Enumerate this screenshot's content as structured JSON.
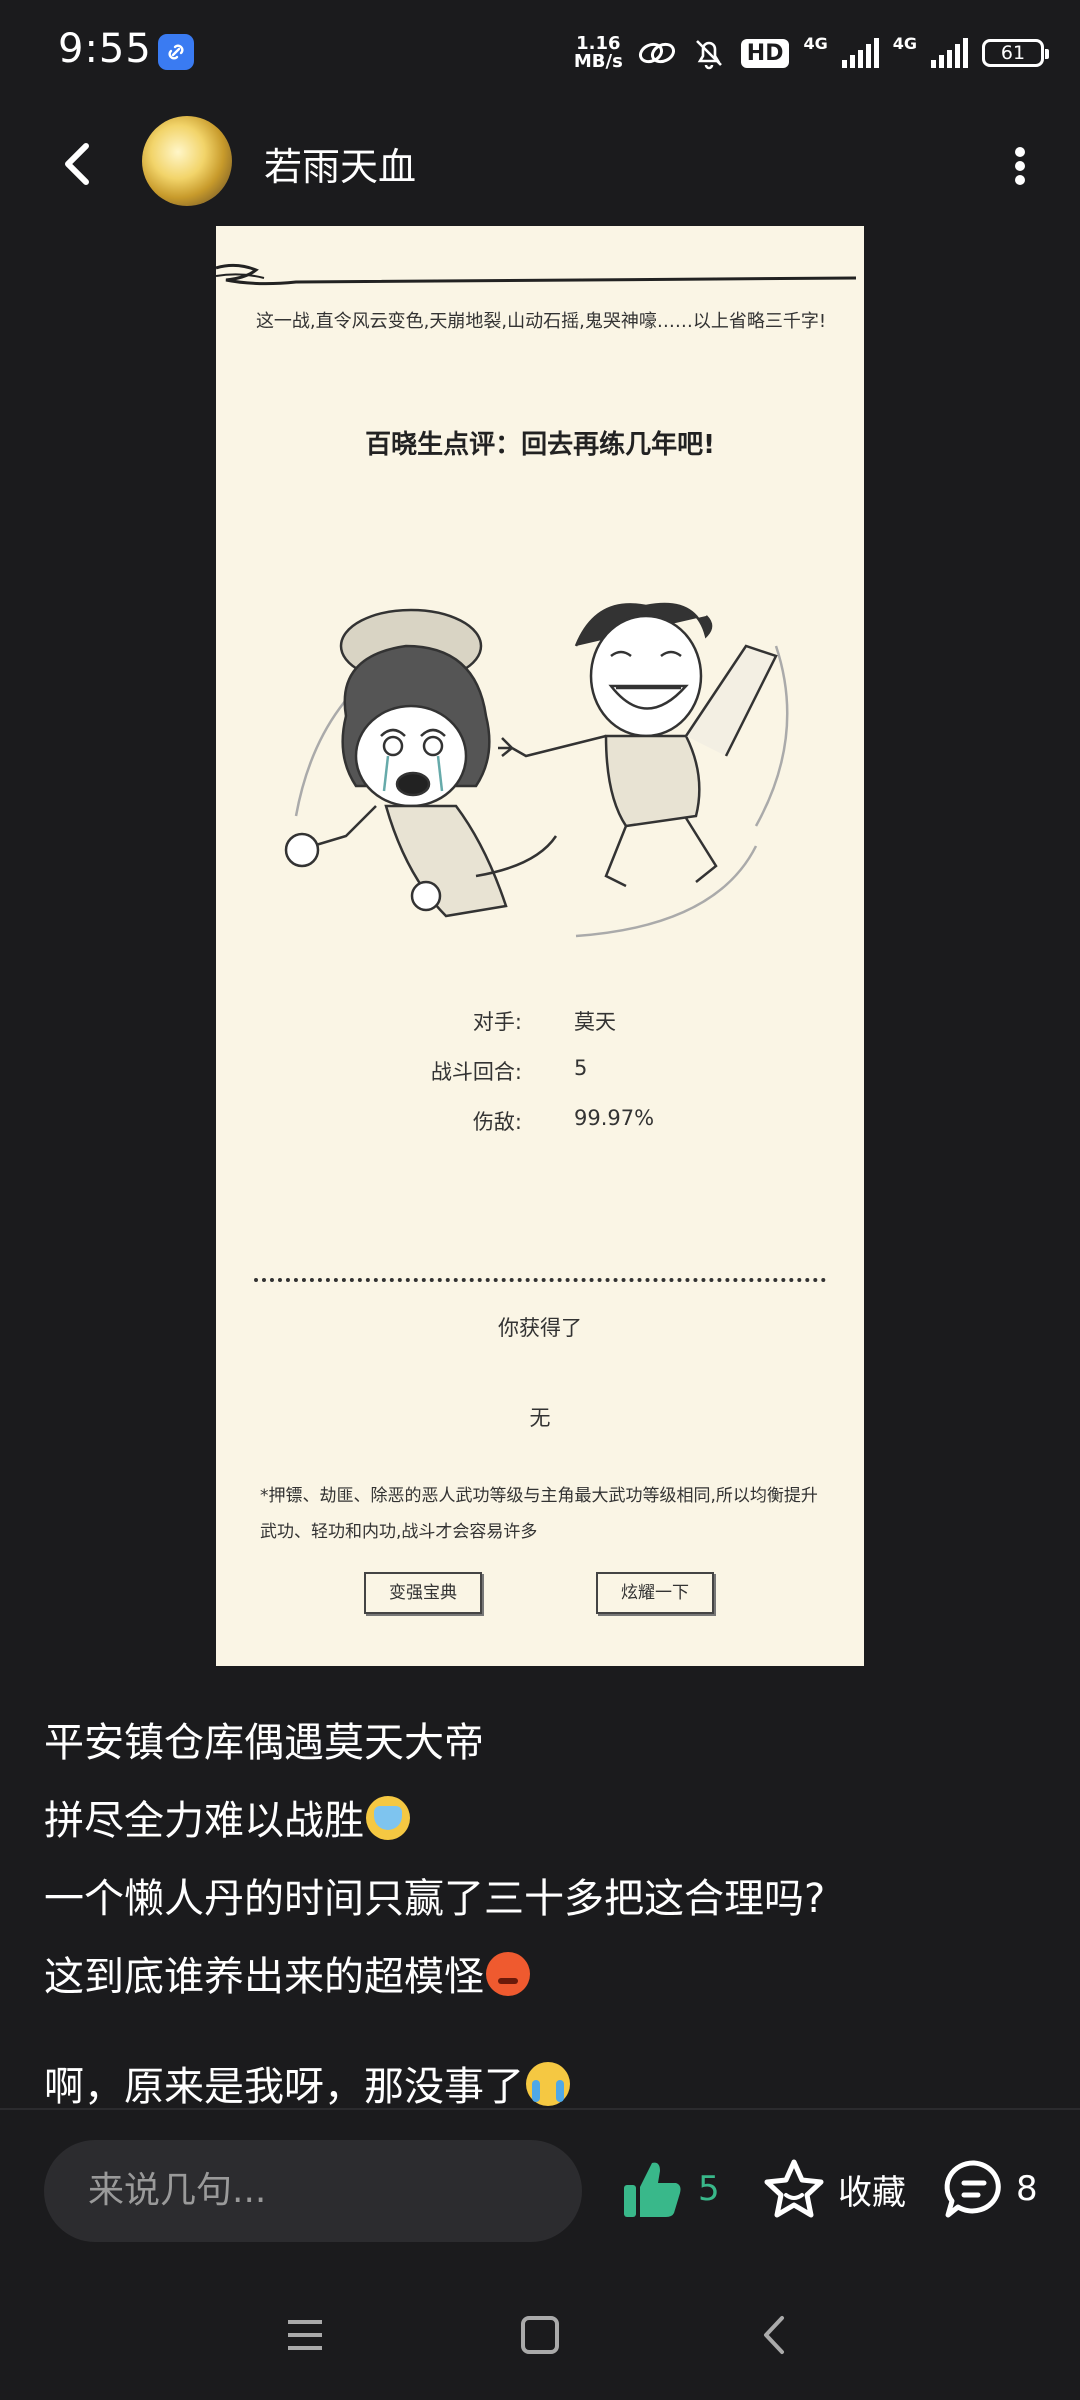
{
  "status_bar": {
    "time": "9:55",
    "net_speed_value": "1.16",
    "net_speed_unit": "MB/s",
    "hd_label": "HD",
    "net_type_1": "4G",
    "net_type_2": "4G",
    "battery": "61"
  },
  "header": {
    "username": "若雨天血"
  },
  "card": {
    "intro": "这一战,直令风云变色,天崩地裂,山动石摇,鬼哭神嚎……以上省略三千字!",
    "title": "百晓生点评：回去再练几年吧!",
    "stats": [
      {
        "label": "对手:",
        "value": "莫天"
      },
      {
        "label": "战斗回合:",
        "value": "5"
      },
      {
        "label": "伤敌:",
        "value": "99.97%"
      }
    ],
    "gained_label": "你获得了",
    "gained_value": "无",
    "tip": "*押镖、劫匪、除恶的恶人武功等级与主角最大武功等级相同,所以均衡提升武功、轻功和内功,战斗才会容易许多",
    "button_left": "变强宝典",
    "button_right": "炫耀一下"
  },
  "post": {
    "line1": "平安镇仓库偶遇莫天大帝",
    "line2": "拼尽全力难以战胜",
    "line3": "一个懒人丹的时间只赢了三十多把这合理吗?",
    "line4": "这到底谁养出来的超模怪",
    "line5": "啊，原来是我呀，那没事了"
  },
  "bottom_bar": {
    "comment_placeholder": "来说几句...",
    "like_count": "5",
    "favorite_label": "收藏",
    "comment_count": "8"
  },
  "colors": {
    "background": "#1b1b1d",
    "accent_green": "#39b88a",
    "card_bg": "#faf5e5"
  }
}
